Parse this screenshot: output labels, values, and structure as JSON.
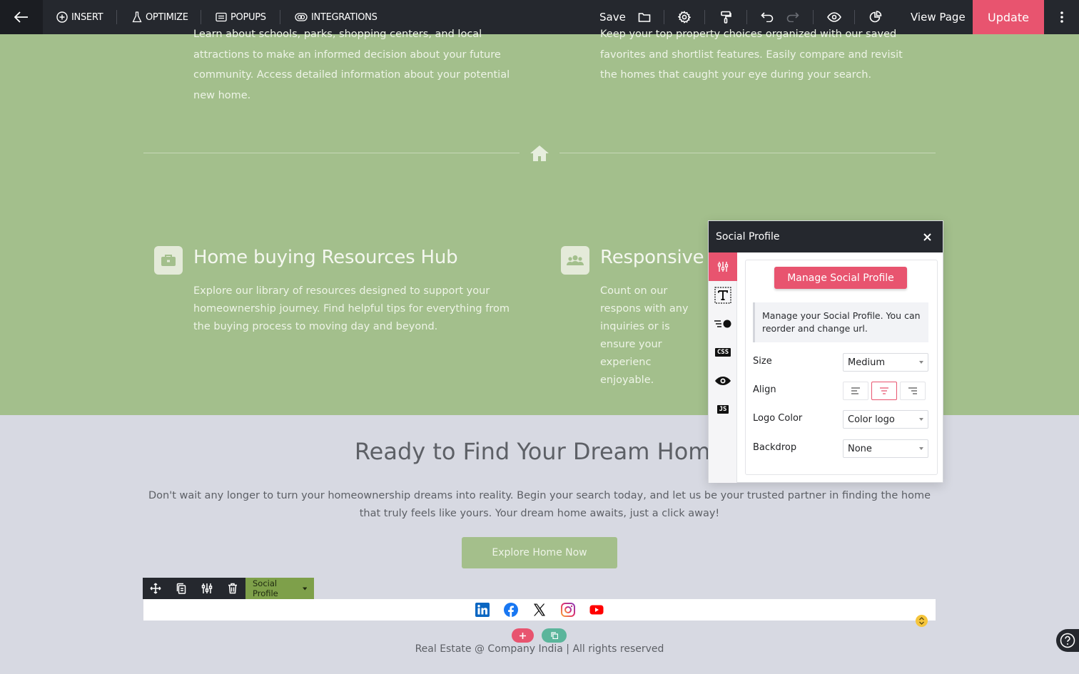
{
  "topbar": {
    "insert_label": "INSERT",
    "optimize_label": "OPTIMIZE",
    "popups_label": "POPUPS",
    "integrations_label": "INTEGRATIONS",
    "save_label": "Save",
    "view_page_label": "View Page",
    "update_label": "Update"
  },
  "green_section": {
    "top_left_text": "Learn about schools, parks, shopping centers, and local attractions to make an informed decision about your future community. Access detailed information about your potential new home.",
    "top_right_text": "Keep your top property choices organized with our saved favorites and shortlist features. Easily compare and revisit the homes that caught your eye during your search.",
    "feature_left": {
      "title": "Home buying Resources Hub",
      "text": "Explore our library of resources designed to support your homeownership journey. Find helpful tips for everything from the buying process to moving day and beyond."
    },
    "feature_right": {
      "title": "Responsive C",
      "text": "Count on our respons with any inquiries or is ensure your experienc enjoyable."
    },
    "colors": {
      "background": "#a3bf8c"
    }
  },
  "cta": {
    "title": "Ready to Find Your Dream Home",
    "text": "Don't wait any longer to turn your homeownership dreams into reality. Begin your search today, and let us be your trusted partner in finding the home that truly feels like yours. Your dream home awaits, just a click away!",
    "button_label": "Explore Home Now"
  },
  "element_toolbar": {
    "label": "Social Profile"
  },
  "social_icons": [
    "linkedin-icon",
    "facebook-icon",
    "x-icon",
    "instagram-icon",
    "youtube-icon"
  ],
  "footer": {
    "text": "Real Estate @ Company India | All rights reserved"
  },
  "panel": {
    "title": "Social Profile",
    "manage_button": "Manage Social Profile",
    "info_text": "Manage your Social Profile. You can reorder and change url.",
    "size_label": "Size",
    "size_value": "Medium",
    "align_label": "Align",
    "align_value": "center",
    "logo_color_label": "Logo Color",
    "logo_color_value": "Color logo",
    "backdrop_label": "Backdrop",
    "backdrop_value": "None",
    "side_tabs": [
      "settings-icon",
      "typography-icon",
      "animation-icon",
      "CSS",
      "visibility-icon",
      "JS"
    ],
    "css_badge": "CSS",
    "js_badge": "JS"
  },
  "accent_color": "#e8546f"
}
